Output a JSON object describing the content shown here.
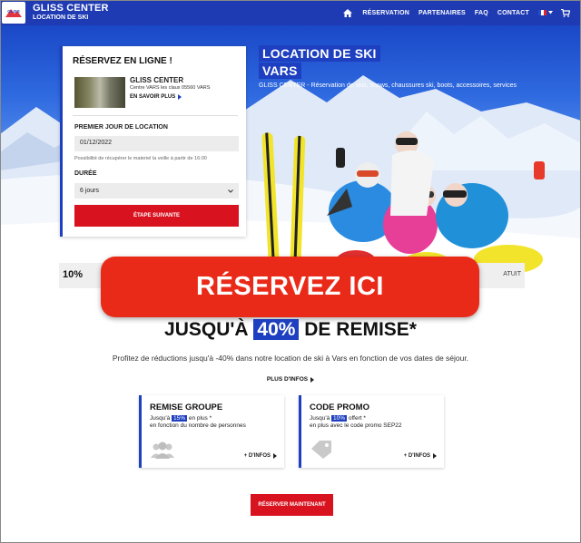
{
  "header": {
    "brand_line1": "GLISS CENTER",
    "brand_line2": "LOCATION DE SKI",
    "logo_text": "GLISS",
    "nav": [
      "RÉSERVATION",
      "PARTENAIRES",
      "FAQ",
      "CONTACT"
    ],
    "icons": [
      "home-icon",
      "flag-fr-icon",
      "cart-icon"
    ],
    "brand_color": "#1f3bb3"
  },
  "hero": {
    "title_line1": "LOCATION DE SKI",
    "title_line2": "VARS",
    "subtitle": "GLISS CENTER - Réservation de skis, snows, chaussures ski, boots, accessoires, services"
  },
  "booking": {
    "title": "RÉSERVEZ EN LIGNE !",
    "shop_name": "GLISS CENTER",
    "shop_address": "Centre VARS les claux 05560 VARS",
    "more_label": "EN SAVOIR PLUS",
    "first_day_label": "PREMIER JOUR DE LOCATION",
    "first_day_value": "01/12/2022",
    "hint": "Possibilité de récupérer le materiel la veille à partir de 16:00",
    "duration_label": "DURÉE",
    "duration_value": "6 jours",
    "next_label": "ÉTAPE SUIVANTE"
  },
  "strip": {
    "left_text": "10%",
    "right_text": "ATUIT"
  },
  "overlay_button": {
    "label": "RÉSERVEZ ICI",
    "color": "#ea2a18"
  },
  "discount": {
    "headline_pre": "JUSQU'À",
    "headline_hl": "40%",
    "headline_post": "DE REMISE*",
    "description": "Profitez de réductions jusqu'à -40% dans notre location de ski à Vars en fonction de vos dates de séjour.",
    "more_label": "PLUS D'INFOS",
    "cards": [
      {
        "title": "REMISE GROUPE",
        "pre": "Jusqu'à",
        "badge": "15%",
        "post": "en plus *",
        "line2": "en fonction du nombre de personnes",
        "info": "+ D'INFOS",
        "icon": "group-icon"
      },
      {
        "title": "CODE PROMO",
        "pre": "Jusqu'à",
        "badge": "10%",
        "post": "offert *",
        "line2": "en plus avec le code promo SEP22",
        "info": "+ D'INFOS",
        "icon": "tag-icon"
      }
    ],
    "reserve_label": "RÉSERVER MAINTENANT"
  }
}
